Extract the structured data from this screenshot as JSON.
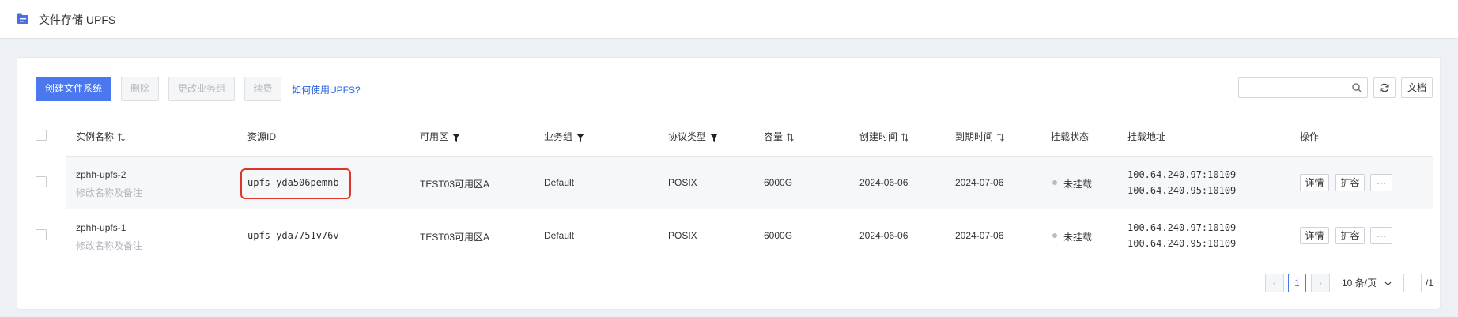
{
  "header": {
    "title": "文件存储 UPFS",
    "icon": "file-storage-icon"
  },
  "toolbar": {
    "create": "创建文件系统",
    "delete": "删除",
    "change_group": "更改业务组",
    "renew": "续费",
    "help_link": "如何使用UPFS?",
    "search_placeholder": "",
    "docs": "文档"
  },
  "table": {
    "headers": {
      "name": "实例名称",
      "resource_id": "资源ID",
      "zone": "可用区",
      "group": "业务组",
      "protocol": "协议类型",
      "capacity": "容量",
      "created": "创建时间",
      "expires": "到期时间",
      "mount_status": "挂载状态",
      "mount_address": "挂载地址",
      "actions": "操作"
    },
    "rows": [
      {
        "name": "zphh-upfs-2",
        "remark": "修改名称及备注",
        "resource_id": "upfs-yda506pemnb",
        "zone": "TEST03可用区A",
        "group": "Default",
        "protocol": "POSIX",
        "capacity": "6000G",
        "created": "2024-06-06",
        "expires": "2024-07-06",
        "mount_status": "未挂载",
        "mount_addr_1": "100.64.240.97:10109",
        "mount_addr_2": "100.64.240.95:10109",
        "action_detail": "详情",
        "action_expand": "扩容",
        "action_more": "···"
      },
      {
        "name": "zphh-upfs-1",
        "remark": "修改名称及备注",
        "resource_id": "upfs-yda7751v76v",
        "zone": "TEST03可用区A",
        "group": "Default",
        "protocol": "POSIX",
        "capacity": "6000G",
        "created": "2024-06-06",
        "expires": "2024-07-06",
        "mount_status": "未挂载",
        "mount_addr_1": "100.64.240.97:10109",
        "mount_addr_2": "100.64.240.95:10109",
        "action_detail": "详情",
        "action_expand": "扩容",
        "action_more": "···"
      }
    ]
  },
  "pagination": {
    "prev": "‹",
    "current_page": "1",
    "next": "›",
    "page_size": "10 条/页",
    "jump_value": "",
    "total_pages": "/1"
  },
  "colors": {
    "primary": "#4b78ef",
    "link": "#2a63e0",
    "highlight": "#e0342a"
  }
}
